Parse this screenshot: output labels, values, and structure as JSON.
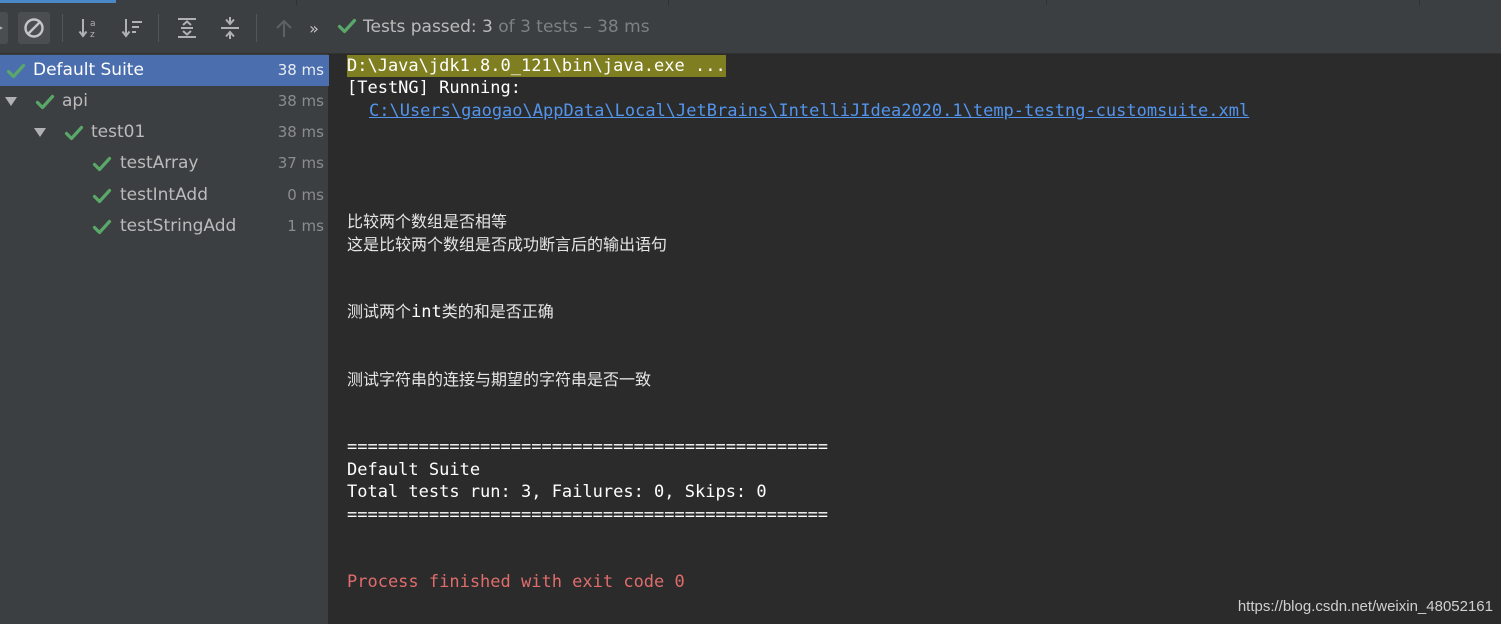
{
  "colors": {
    "pass_green": "#59a869",
    "selection": "#4b6eaf",
    "link": "#5394ec",
    "error": "#e06c6c"
  },
  "toolbar": {
    "buttons": [
      {
        "name": "rerun-failed-icon"
      },
      {
        "name": "stop-icon"
      },
      {
        "name": "sort-alphabetically-icon"
      },
      {
        "name": "sort-by-duration-icon"
      },
      {
        "name": "expand-all-icon"
      },
      {
        "name": "collapse-all-icon"
      },
      {
        "name": "previous-test-icon"
      },
      {
        "name": "more-actions-icon"
      }
    ],
    "status_prefix": "Tests passed: ",
    "status_count": "3",
    "status_suffix": " of 3 tests – 38 ms"
  },
  "tree": {
    "items": [
      {
        "label": "Default Suite",
        "time": "38 ms",
        "level": 0,
        "selected": true
      },
      {
        "label": "api",
        "time": "38 ms",
        "level": 1
      },
      {
        "label": "test01",
        "time": "38 ms",
        "level": 2
      },
      {
        "label": "testArray",
        "time": "37 ms",
        "level": 3
      },
      {
        "label": "testIntAdd",
        "time": "0 ms",
        "level": 3
      },
      {
        "label": "testStringAdd",
        "time": "1 ms",
        "level": 3
      }
    ]
  },
  "console": {
    "command": "D:\\Java\\jdk1.8.0_121\\bin\\java.exe ...",
    "running": "[TestNG] Running:",
    "suite_path": "C:\\Users\\gaogao\\AppData\\Local\\JetBrains\\IntelliJIdea2020.1\\temp-testng-customsuite.xml",
    "out1": "比较两个数组是否相等",
    "out2": "这是比较两个数组是否成功断言后的输出语句",
    "out3_pre": "测试两个",
    "out3_code": "int",
    "out3_post": "类的和是否正确",
    "out4": "测试字符串的连接与期望的字符串是否一致",
    "separator1": "===============================================",
    "summary_suite": "Default Suite",
    "summary_totals": "Total tests run: 3, Failures: 0, Skips: 0",
    "separator2": "===============================================",
    "exit": "Process finished with exit code 0"
  },
  "watermark": "https://blog.csdn.net/weixin_48052161"
}
